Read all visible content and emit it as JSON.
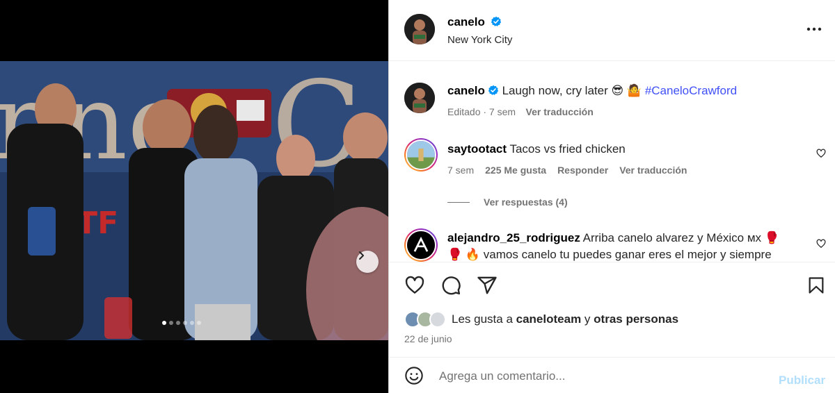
{
  "post": {
    "author": "canelo",
    "location": "New York City",
    "caption_user": "canelo",
    "caption_text": "Laugh now, cry later 😎 🤷",
    "caption_hashtag": "#CaneloCrawford",
    "caption_meta": "Editado · 7 sem",
    "caption_translate": "Ver traducción"
  },
  "comments": [
    {
      "user": "saytootact",
      "text": "Tacos vs fried chicken",
      "time": "7 sem",
      "likes": "225 Me gusta",
      "reply": "Responder",
      "translate": "Ver traducción",
      "view_replies": "Ver respuestas (4)"
    },
    {
      "user": "alejandro_25_rodriguez",
      "text_line1": "Arriba canelo alvarez y México мх 🥊",
      "text_line2": "🥊 🔥 vamos canelo tu puedes ganar eres el mejor y siempre"
    }
  ],
  "likes": {
    "prefix": "Les gusta a",
    "user": "caneloteam",
    "conj": "y",
    "others": "otras personas"
  },
  "date": "22 de junio",
  "composer": {
    "placeholder": "Agrega un comentario...",
    "publish": "Publicar"
  },
  "carousel": {
    "count": 6,
    "active_index": 0
  },
  "colors": {
    "verified": "#0095f6",
    "hashtag": "#4150f7",
    "publish_disabled": "#b2dffc",
    "muted": "#737373"
  },
  "icons": [
    "more-options-icon",
    "verified-badge-icon",
    "heart-icon",
    "comment-icon",
    "share-icon",
    "bookmark-icon",
    "emoji-icon",
    "chevron-right-icon"
  ]
}
